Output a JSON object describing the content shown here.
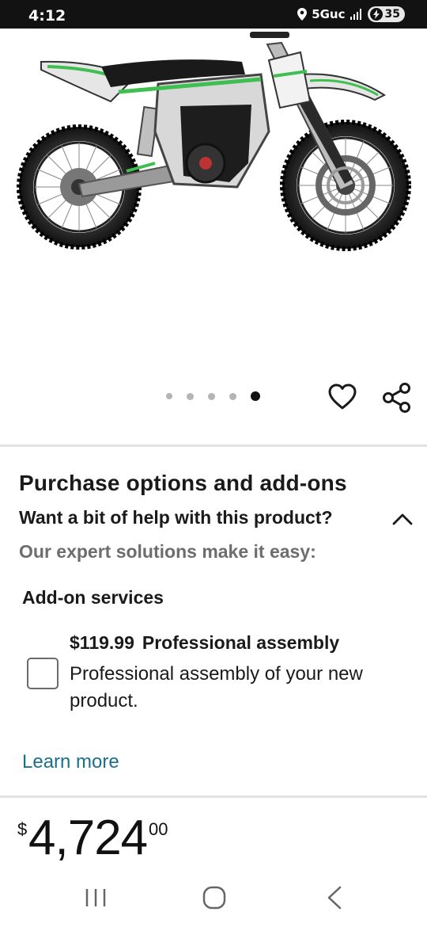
{
  "status_bar": {
    "time": "4:12",
    "network": "5Guc",
    "battery": "35"
  },
  "product": {
    "image_alt": "Electric dirt bike (green, black and white)",
    "carousel": {
      "count": 5,
      "active_index": 4
    }
  },
  "purchase_options": {
    "title": "Purchase options and add-ons",
    "help_question": "Want a bit of help with this product?",
    "expert_tagline": "Our expert solutions make it easy:",
    "addon_heading": "Add-on services",
    "addon": {
      "price": "$119.99",
      "name": "Professional assembly",
      "description": "Professional assembly of your new product.",
      "checked": false
    },
    "learn_more": "Learn more"
  },
  "price": {
    "currency": "$",
    "whole": "4,724",
    "cents": "00"
  },
  "colors": {
    "accent_link": "#1c6f8c",
    "bike_green": "#3fbf4f"
  },
  "icons": [
    "location-icon",
    "signal-icon",
    "battery-icon",
    "heart-icon",
    "share-icon",
    "chevron-up-icon",
    "recent-apps-icon",
    "home-icon",
    "back-icon"
  ]
}
